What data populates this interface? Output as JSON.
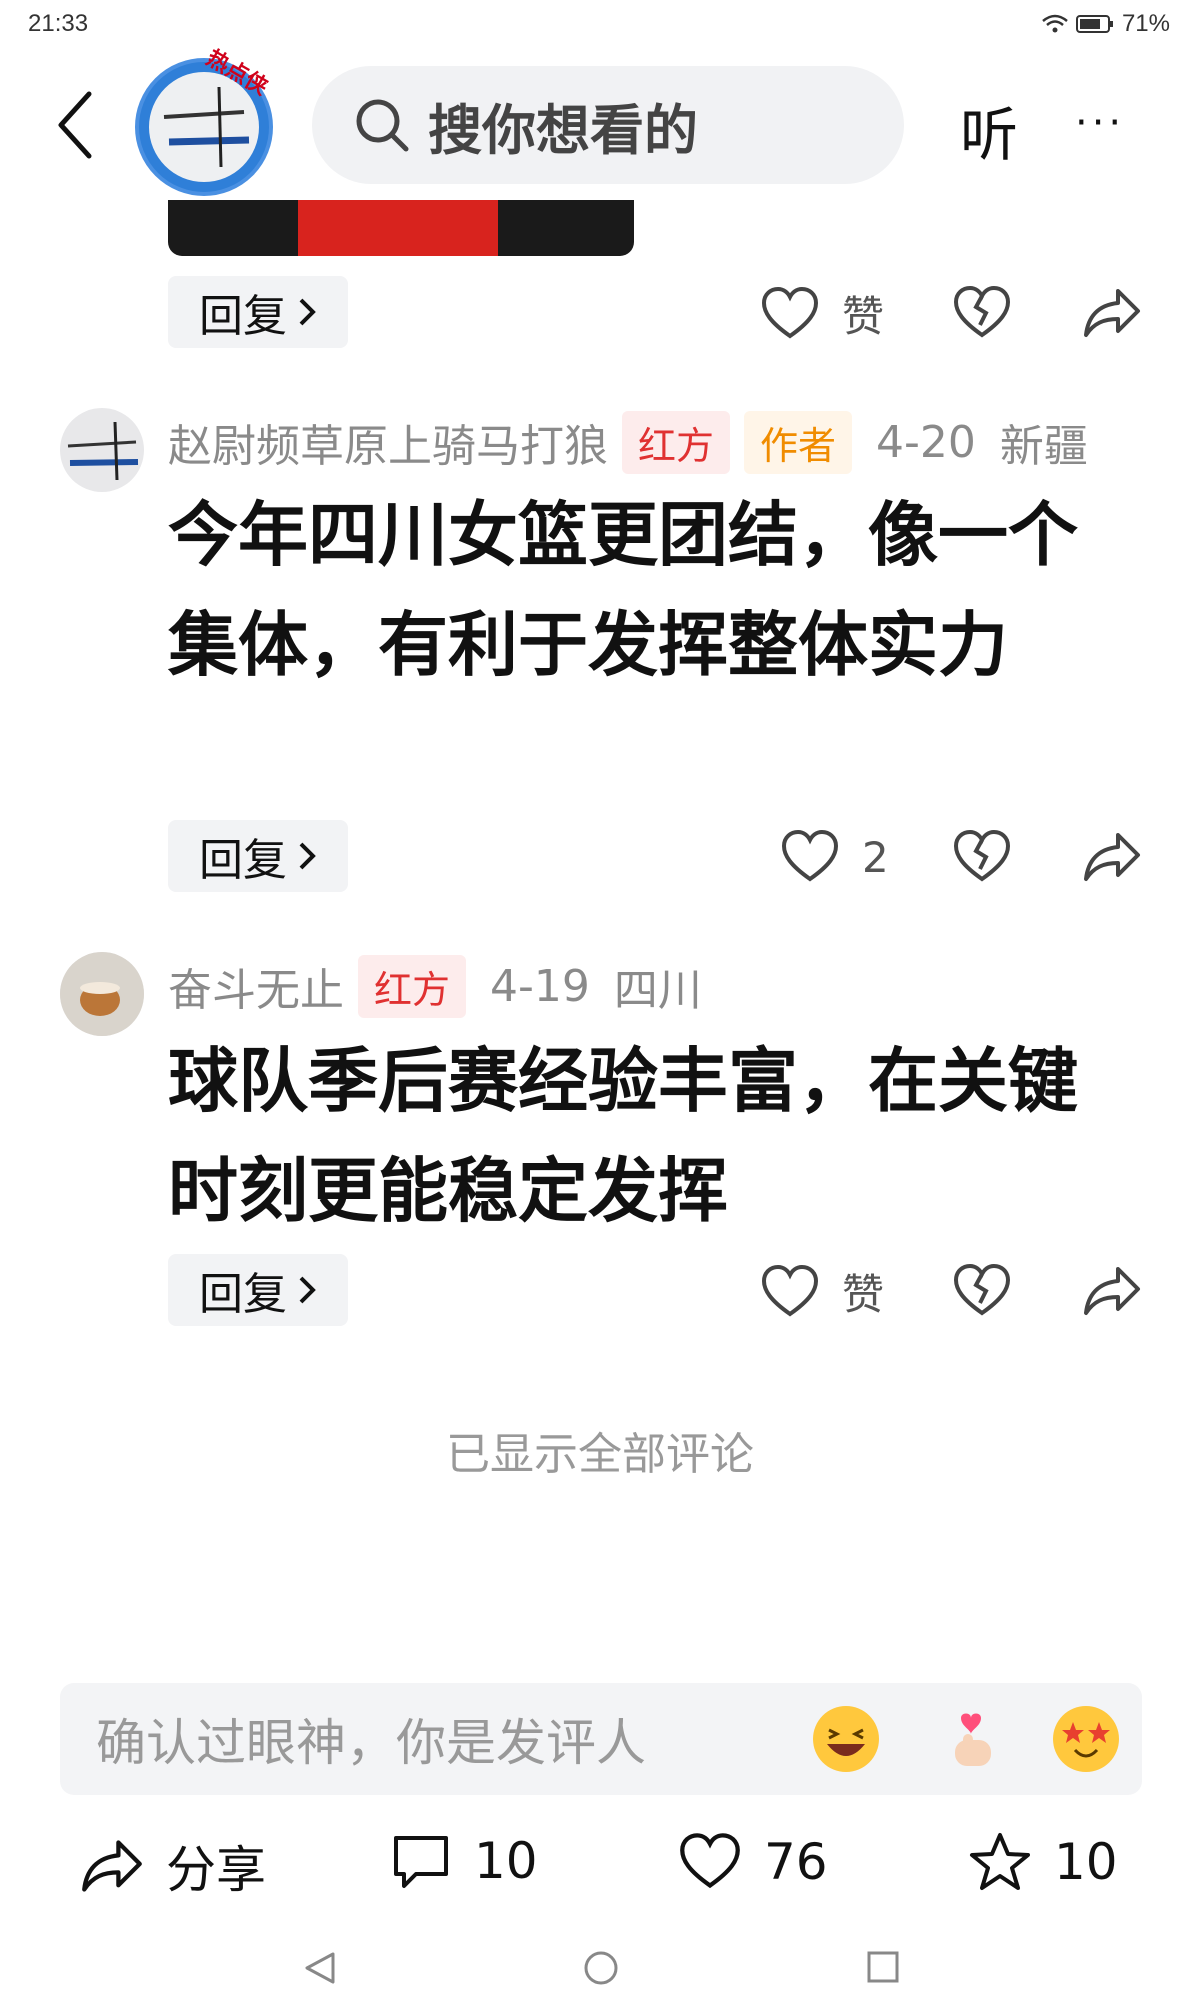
{
  "status_bar": {
    "time": "21:33",
    "battery": "71%"
  },
  "header": {
    "topic_badge": "热点侠",
    "search_placeholder": "搜你想看的",
    "listen_label": "听",
    "more_label": "···"
  },
  "reply_label": "回复",
  "like_label": "赞",
  "comments": [
    {
      "username": "赵尉频草原上骑马打狼",
      "tags": [
        "红方",
        "作者"
      ],
      "date": "4-20",
      "location": "新疆",
      "text": "今年四川女篮更团结，像一个集体，有利于发挥整体实力",
      "likes": "2"
    },
    {
      "username": "奋斗无止",
      "tags": [
        "红方"
      ],
      "date": "4-19",
      "location": "四川",
      "text": "球队季后赛经验丰富，在关键时刻更能稳定发挥",
      "likes": "赞"
    }
  ],
  "end_note": "已显示全部评论",
  "input": {
    "placeholder": "确认过眼神，你是发评人"
  },
  "bottom_bar": {
    "share_label": "分享",
    "comment_count": "10",
    "like_count": "76",
    "favorite_count": "10"
  },
  "colors": {
    "tag_red": "#e03131",
    "tag_author": "#f08c00",
    "text_gray": "#8a8a8a"
  },
  "icons": [
    "back-icon",
    "search-icon",
    "heart-icon",
    "broken-heart-icon",
    "share-icon",
    "comment-icon",
    "star-icon"
  ]
}
